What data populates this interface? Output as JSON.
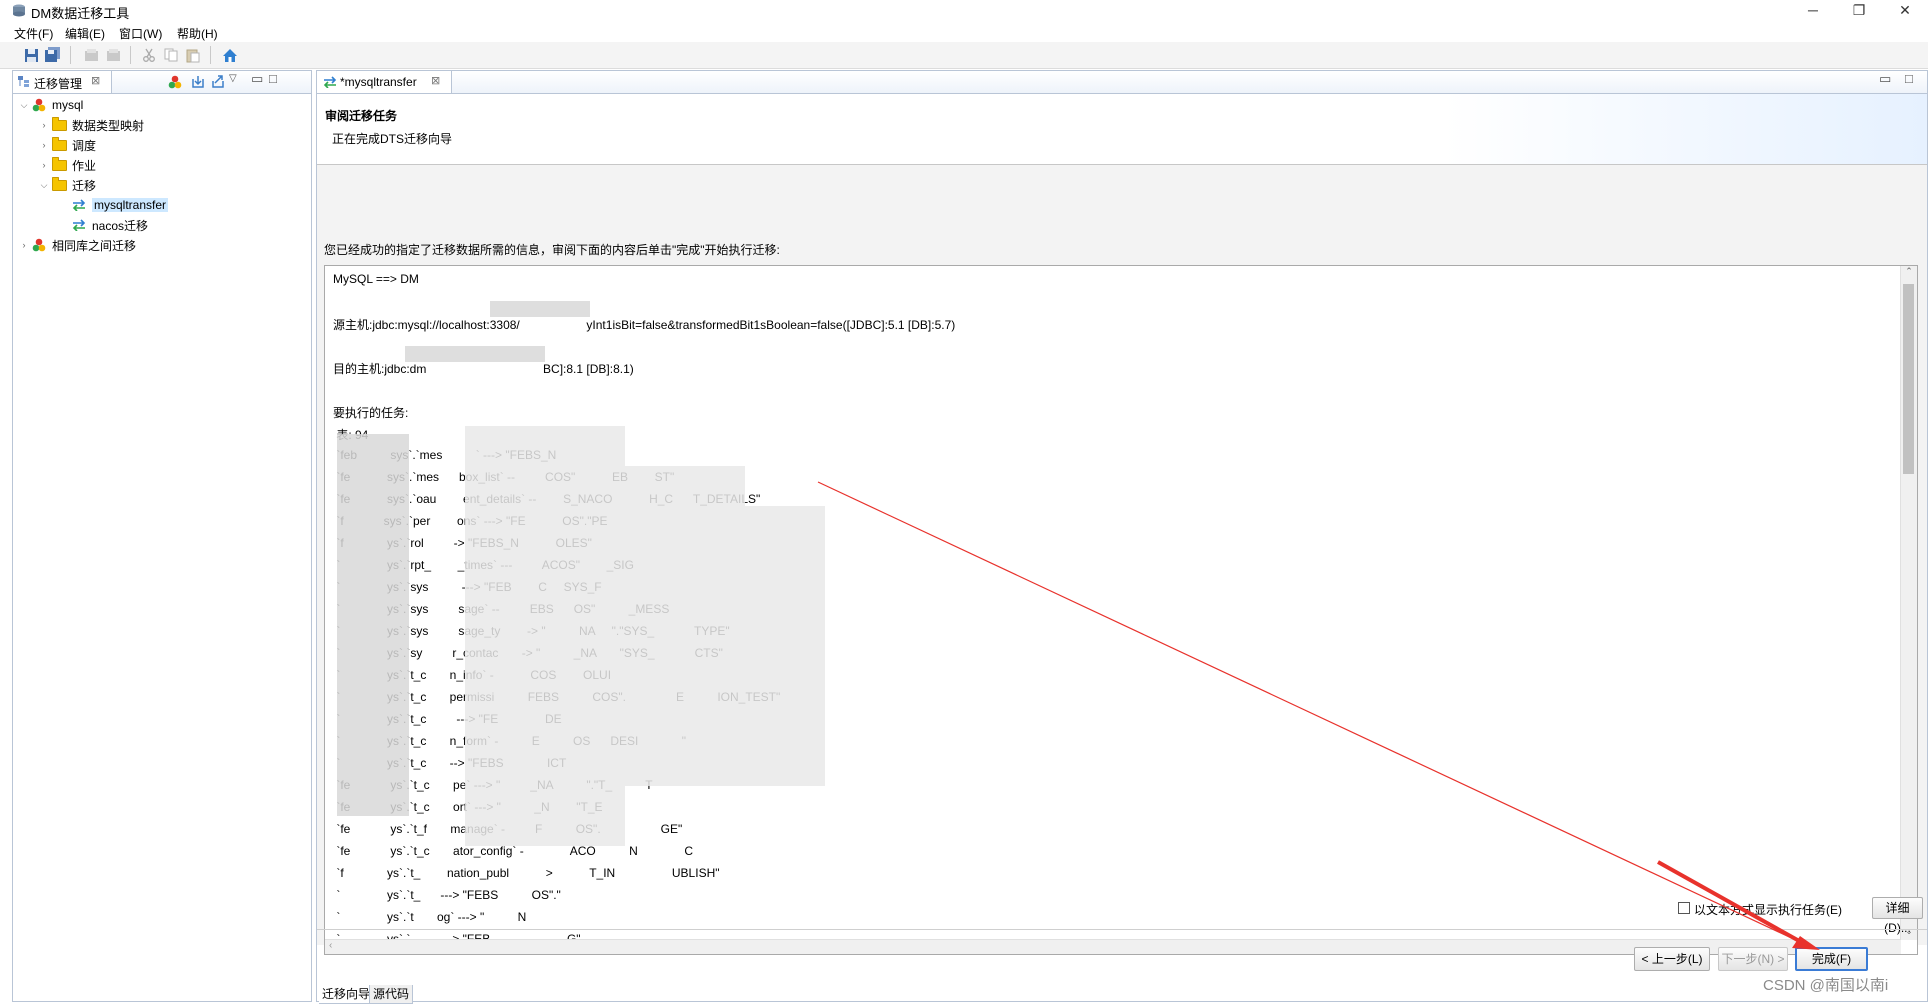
{
  "window": {
    "title": "DM数据迁移工具",
    "controls": [
      "─",
      "❐",
      "✕"
    ]
  },
  "menu": [
    "文件(F)",
    "编辑(E)",
    "窗口(W)",
    "帮助(H)"
  ],
  "left_panel": {
    "tab_label": "迁移管理",
    "tree": [
      {
        "label": "mysql",
        "level": 0,
        "expanded": true,
        "icon": "database-icon"
      },
      {
        "label": "数据类型映射",
        "level": 1,
        "expanded": false,
        "icon": "folder-icon"
      },
      {
        "label": "调度",
        "level": 1,
        "expanded": false,
        "icon": "folder-icon"
      },
      {
        "label": "作业",
        "level": 1,
        "expanded": false,
        "icon": "folder-icon"
      },
      {
        "label": "迁移",
        "level": 1,
        "expanded": true,
        "icon": "folder-icon"
      },
      {
        "label": "mysqltransfer",
        "level": 2,
        "selected": true,
        "icon": "transfer-icon"
      },
      {
        "label": "nacos迁移",
        "level": 2,
        "icon": "transfer-icon"
      },
      {
        "label": "相同库之间迁移",
        "level": 0,
        "expanded": false,
        "icon": "database-icon"
      }
    ]
  },
  "editor": {
    "tab_label": "*mysqltransfer",
    "wizard_title": "审阅迁移任务",
    "wizard_subtitle": "正在完成DTS迁移向导",
    "instruction": "您已经成功的指定了迁移数据所需的信息，审阅下面的内容后单击\"完成\"开始执行迁移:",
    "summary_lines": [
      "MySQL ==> DM",
      "",
      "源主机:jdbc:mysql://localhost:3308/                    yInt1isBit=false&transformedBit1sBoolean=false([JDBC]:5.1 [DB]:5.7)",
      "",
      "目的主机:jdbc:dm                                   BC]:8.1 [DB]:8.1)",
      "",
      "要执行的任务:",
      " 表: 94",
      " `feb          sys`.`mes          ` ---> \"FEBS_N",
      " `fe           sys`.`mes      box_list` --         COS\"           EB        ST\"",
      " `fe           sys`.`oau        ent_details` --        S_NACO           H_C      T_DETAILS\"",
      " `f            sys`.`per        ons` ---> \"FE           OS\".\"PE",
      " `f             ys`.`rol         -> \"FEBS_N           OLES\"",
      " `              ys`.`rpt_        _times` ---         ACOS\"        _SIG",
      " `              ys`.`sys          ---> \"FEB        C     SYS_F",
      " `              ys`.`sys         sage` --         EBS      OS\"          _MESS",
      " `              ys`.`sys         sage_ty        -> \"          NA     \".\"SYS_            TYPE\"",
      " `              ys`.`sy         r_contac       -> \"          _NA       \"SYS_            CTS\"",
      " `              ys`.`t_c       n_info` -           COS        OLUI",
      " `              ys`.`t_c       permissi          FEBS          COS\".               E          ION_TEST\"",
      " `              ys`.`t_c         ---> \"FE              DE",
      " `              ys`.`t_c       n_form` -          E          OS      DESI             \"",
      " `              ys`.`t_c       --> \"FEBS             ICT",
      " `fe            ys`.`t_c       pe` ---> \"         _NA          \".\"T_          T",
      " `fe            ys`.`t_c       ort` ---> \"          _N        \"T_E",
      " `fe            ys`.`t_f       manage` -         F          OS\".                  GE\"",
      " `fe            ys`.`t_c       ator_config` -              ACO          N              C",
      " `f             ys`.`t_        nation_publ           >           T_IN                 UBLISH\"",
      " `              ys`.`t_      ---> \"FEBS          OS\".\"",
      " `              ys`.`t       og` ---> \"          N",
      " `              ys`.`         ---> \"FEB                       G\""
    ],
    "checkbox_label": "以文本方式显示执行任务(E)",
    "checkbox_checked": false,
    "details_button": "详细(D)...",
    "prev_button": "< 上一步(L)",
    "next_button": "下一步(N) >",
    "finish_button": "完成(F)",
    "bottom_tabs": [
      "迁移向导",
      "源代码"
    ]
  },
  "watermark": "CSDN @南国以南i",
  "colors": {
    "annotation_arrow": "#e8322c",
    "selection": "#cde8ff",
    "panel_border": "#b9c5d6"
  }
}
